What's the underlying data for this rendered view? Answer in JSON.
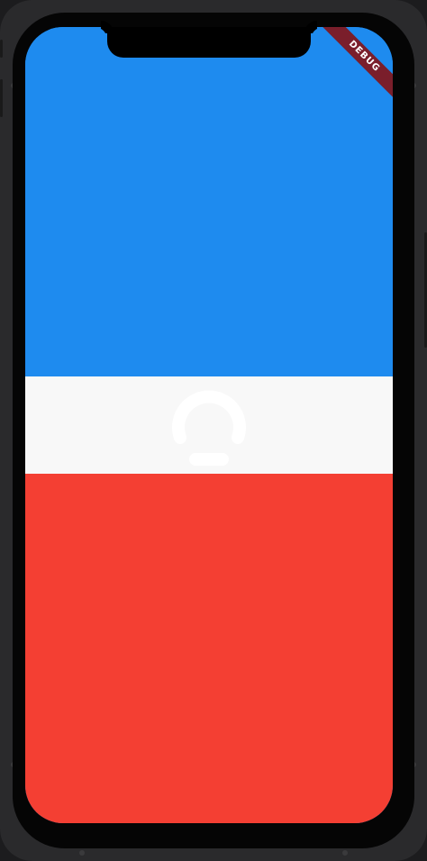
{
  "app": {
    "debug_banner": "DEBUG"
  },
  "panels": {
    "top": {
      "color": "#1e8bef"
    },
    "middle": {
      "color": "#f8f8f8"
    },
    "bottom": {
      "color": "#f43f33"
    }
  },
  "loading": {
    "icon": "spinner-icon"
  },
  "device": {
    "bezel_color": "#050505",
    "frame_color": "#2a2a2c"
  }
}
